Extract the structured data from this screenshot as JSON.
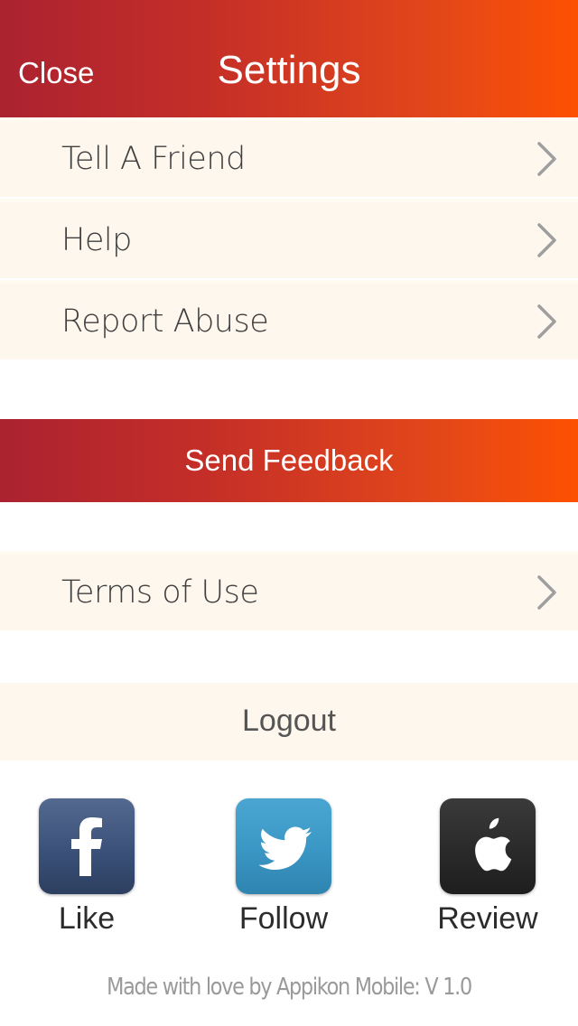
{
  "header": {
    "title": "Settings",
    "close_label": "Close"
  },
  "menu": {
    "items": [
      {
        "label": "Tell A Friend"
      },
      {
        "label": "Help"
      },
      {
        "label": "Report Abuse"
      }
    ]
  },
  "send_feedback_label": "Send Feedback",
  "terms": {
    "label": "Terms of Use"
  },
  "logout_label": "Logout",
  "social": [
    {
      "icon": "facebook-icon",
      "label": "Like",
      "color": "#3b5179"
    },
    {
      "icon": "twitter-icon",
      "label": "Follow",
      "color": "#3a96c3"
    },
    {
      "icon": "apple-icon",
      "label": "Review",
      "color": "#2a2a2a"
    }
  ],
  "footer_text": "Made with love by Appikon Mobile: V 1.0",
  "colors": {
    "gradient_start": "#ab2230",
    "gradient_end": "#fd5102",
    "row_background": "#fdf7ee",
    "text_dark": "#3f3f3f",
    "chevron": "#9e9e9e"
  }
}
